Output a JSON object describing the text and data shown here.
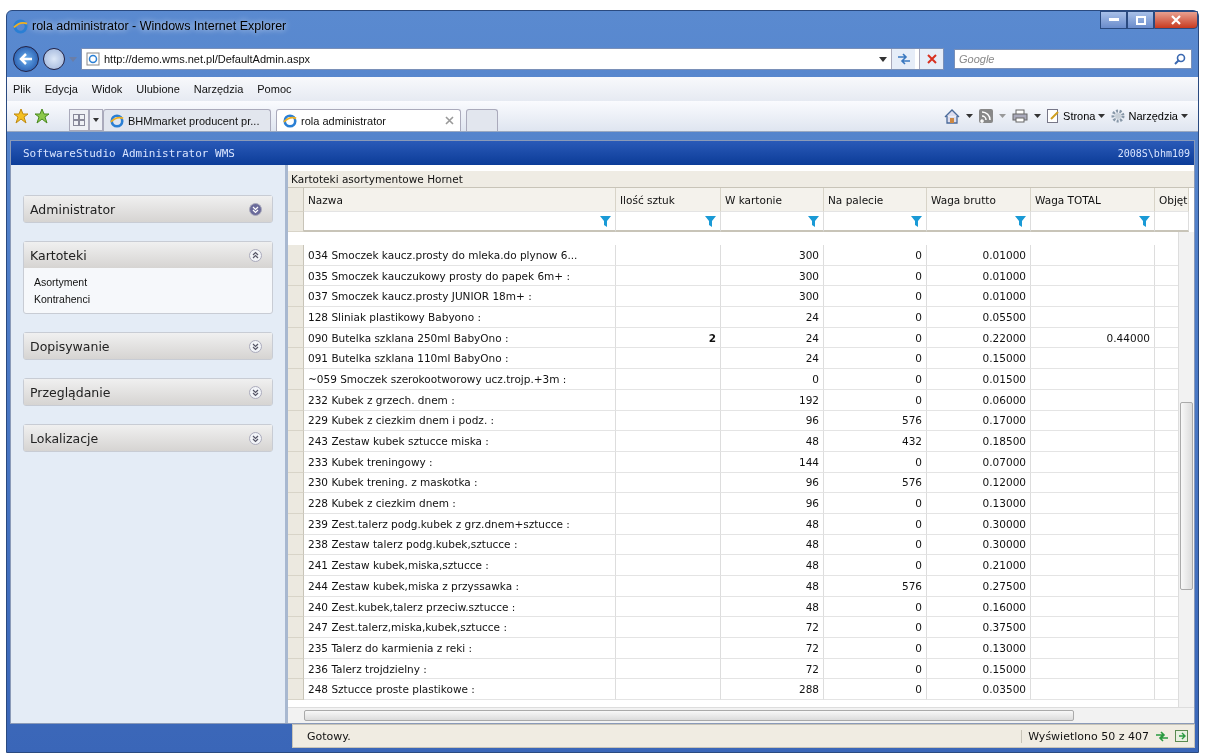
{
  "window": {
    "title": "rola administrator - Windows Internet Explorer"
  },
  "address_bar": {
    "url": "http://demo.wms.net.pl/DefaultAdmin.aspx"
  },
  "search": {
    "placeholder": "Google"
  },
  "menu": [
    "Plik",
    "Edycja",
    "Widok",
    "Ulubione",
    "Narzędzia",
    "Pomoc"
  ],
  "tabs": [
    {
      "label": "BHMmarket producent pr...",
      "selected": false
    },
    {
      "label": "rola administrator",
      "selected": true
    }
  ],
  "command_bar": [
    "Strona",
    "Narzędzia"
  ],
  "app": {
    "title": "SoftwareStudio Administrator WMS",
    "user": "2008S\\bhm109"
  },
  "sidebar": [
    {
      "label": "Administrator",
      "expanded": false
    },
    {
      "label": "Kartoteki",
      "expanded": true,
      "children": [
        "Asortyment",
        "Kontrahenci"
      ]
    },
    {
      "label": "Dopisywanie",
      "expanded": false
    },
    {
      "label": "Przeglądanie",
      "expanded": false
    },
    {
      "label": "Lokalizacje",
      "expanded": false
    }
  ],
  "table": {
    "caption": "Kartoteki asortymentowe Hornet",
    "columns": [
      "Nazwa",
      "Ilość sztuk",
      "W kartonie",
      "Na palecie",
      "Waga brutto",
      "Waga TOTAL",
      "Objęt"
    ],
    "rows": [
      [
        "034 Smoczek kaucz.prosty do mleka.do plynow 6...",
        "",
        "300",
        "0",
        "0.01000",
        ""
      ],
      [
        "035 Smoczek kauczukowy prosty do papek 6m+ :",
        "",
        "300",
        "0",
        "0.01000",
        ""
      ],
      [
        "037 Smoczek kaucz.prosty JUNIOR 18m+ :",
        "",
        "300",
        "0",
        "0.01000",
        ""
      ],
      [
        "128 Sliniak plastikowy Babyono :",
        "",
        "24",
        "0",
        "0.05500",
        ""
      ],
      [
        "090 Butelka szklana 250ml BabyOno :",
        "2",
        "24",
        "0",
        "0.22000",
        "0.44000"
      ],
      [
        "091 Butelka szklana 110ml BabyOno :",
        "",
        "24",
        "0",
        "0.15000",
        ""
      ],
      [
        "~059 Smoczek szerokootworowy ucz.trojp.+3m :",
        "",
        "0",
        "0",
        "0.01500",
        ""
      ],
      [
        "232 Kubek z grzech. dnem :",
        "",
        "192",
        "0",
        "0.06000",
        ""
      ],
      [
        "229 Kubek z ciezkim dnem i podz. :",
        "",
        "96",
        "576",
        "0.17000",
        ""
      ],
      [
        "243 Zestaw kubek sztucce miska :",
        "",
        "48",
        "432",
        "0.18500",
        ""
      ],
      [
        "233 Kubek treningowy :",
        "",
        "144",
        "0",
        "0.07000",
        ""
      ],
      [
        "230 Kubek trening. z maskotka :",
        "",
        "96",
        "576",
        "0.12000",
        ""
      ],
      [
        "228 Kubek z ciezkim dnem :",
        "",
        "96",
        "0",
        "0.13000",
        ""
      ],
      [
        "239 Zest.talerz podg.kubek z grz.dnem+sztucce :",
        "",
        "48",
        "0",
        "0.30000",
        ""
      ],
      [
        "238 Zestaw talerz podg.kubek,sztucce :",
        "",
        "48",
        "0",
        "0.30000",
        ""
      ],
      [
        "241 Zestaw kubek,miska,sztucce :",
        "",
        "48",
        "0",
        "0.21000",
        ""
      ],
      [
        "244 Zestaw kubek,miska z przyssawka :",
        "",
        "48",
        "576",
        "0.27500",
        ""
      ],
      [
        "240 Zest.kubek,talerz przeciw.sztucce :",
        "",
        "48",
        "0",
        "0.16000",
        ""
      ],
      [
        "247 Zest.talerz,miska,kubek,sztucce :",
        "",
        "72",
        "0",
        "0.37500",
        ""
      ],
      [
        "235 Talerz do karmienia z reki :",
        "",
        "72",
        "0",
        "0.13000",
        ""
      ],
      [
        "236 Talerz trojdzielny :",
        "",
        "72",
        "0",
        "0.15000",
        ""
      ],
      [
        "248 Sztucce proste plastikowe :",
        "",
        "288",
        "0",
        "0.03500",
        ""
      ]
    ]
  },
  "status_bar": {
    "status": "Gotowy.",
    "count": "Wyświetlono 50 z 407"
  }
}
